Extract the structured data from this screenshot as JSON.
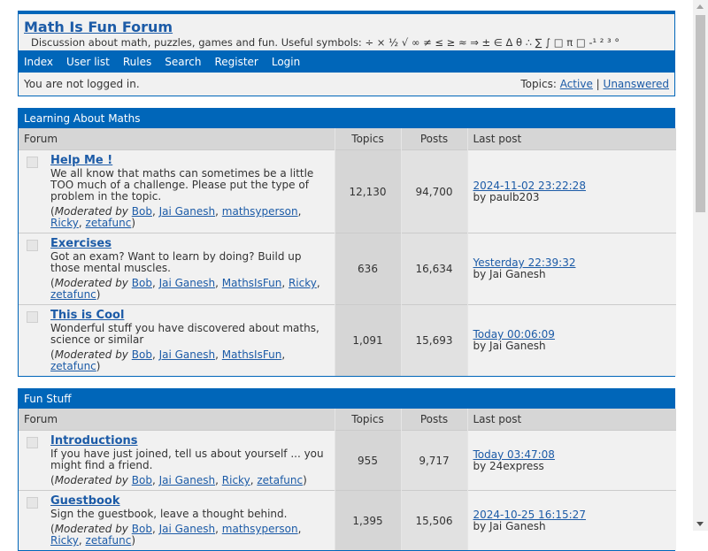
{
  "header": {
    "title": "Math Is Fun Forum",
    "description": "Discussion about math, puzzles, games and fun.   Useful symbols: ÷ × ½ √ ∞ ≠ ≤ ≥ ≈ ⇒ ± ∈ Δ θ ∴ ∑ ∫ □ π □ -¹ ² ³ °"
  },
  "nav": [
    "Index",
    "User list",
    "Rules",
    "Search",
    "Register",
    "Login"
  ],
  "status": {
    "left": "You are not logged in.",
    "topics_label": "Topics:",
    "active": "Active",
    "sep": "|",
    "unanswered": "Unanswered"
  },
  "columns": {
    "forum": "Forum",
    "topics": "Topics",
    "posts": "Posts",
    "last_post": "Last post"
  },
  "categories": [
    {
      "title": "Learning About Maths",
      "forums": [
        {
          "name": "Help Me !",
          "description": "We all know that maths can sometimes be a little TOO much of a challenge. Please put the type of problem in the topic.",
          "moderated_label": "Moderated by",
          "moderators": [
            "Bob",
            "Jai Ganesh",
            "mathsyperson",
            "Ricky",
            "zetafunc"
          ],
          "topics": "12,130",
          "posts": "94,700",
          "last_date": "2024-11-02 23:22:28",
          "last_by": "by paulb203"
        },
        {
          "name": "Exercises",
          "description": "Got an exam? Want to learn by doing? Build up those mental muscles.",
          "moderated_label": "Moderated by",
          "moderators": [
            "Bob",
            "Jai Ganesh",
            "MathsIsFun",
            "Ricky",
            "zetafunc"
          ],
          "topics": "636",
          "posts": "16,634",
          "last_date": "Yesterday 22:39:32",
          "last_by": "by Jai Ganesh"
        },
        {
          "name": "This is Cool",
          "description": "Wonderful stuff you have discovered about maths, science or similar",
          "moderated_label": "Moderated by",
          "moderators": [
            "Bob",
            "Jai Ganesh",
            "MathsIsFun",
            "zetafunc"
          ],
          "topics": "1,091",
          "posts": "15,693",
          "last_date": "Today 00:06:09",
          "last_by": "by Jai Ganesh"
        }
      ]
    },
    {
      "title": "Fun Stuff",
      "forums": [
        {
          "name": "Introductions",
          "description": "If you have just joined, tell us about yourself ... you might find a friend.",
          "moderated_label": "Moderated by",
          "moderators": [
            "Bob",
            "Jai Ganesh",
            "Ricky",
            "zetafunc"
          ],
          "topics": "955",
          "posts": "9,717",
          "last_date": "Today 03:47:08",
          "last_by": "by 24express"
        },
        {
          "name": "Guestbook",
          "description": "Sign the guestbook, leave a thought behind.",
          "moderated_label": "Moderated by",
          "moderators": [
            "Bob",
            "Jai Ganesh",
            "mathsyperson",
            "Ricky",
            "zetafunc"
          ],
          "topics": "1,395",
          "posts": "15,506",
          "last_date": "2024-10-25 16:15:27",
          "last_by": "by Jai Ganesh"
        }
      ]
    }
  ]
}
